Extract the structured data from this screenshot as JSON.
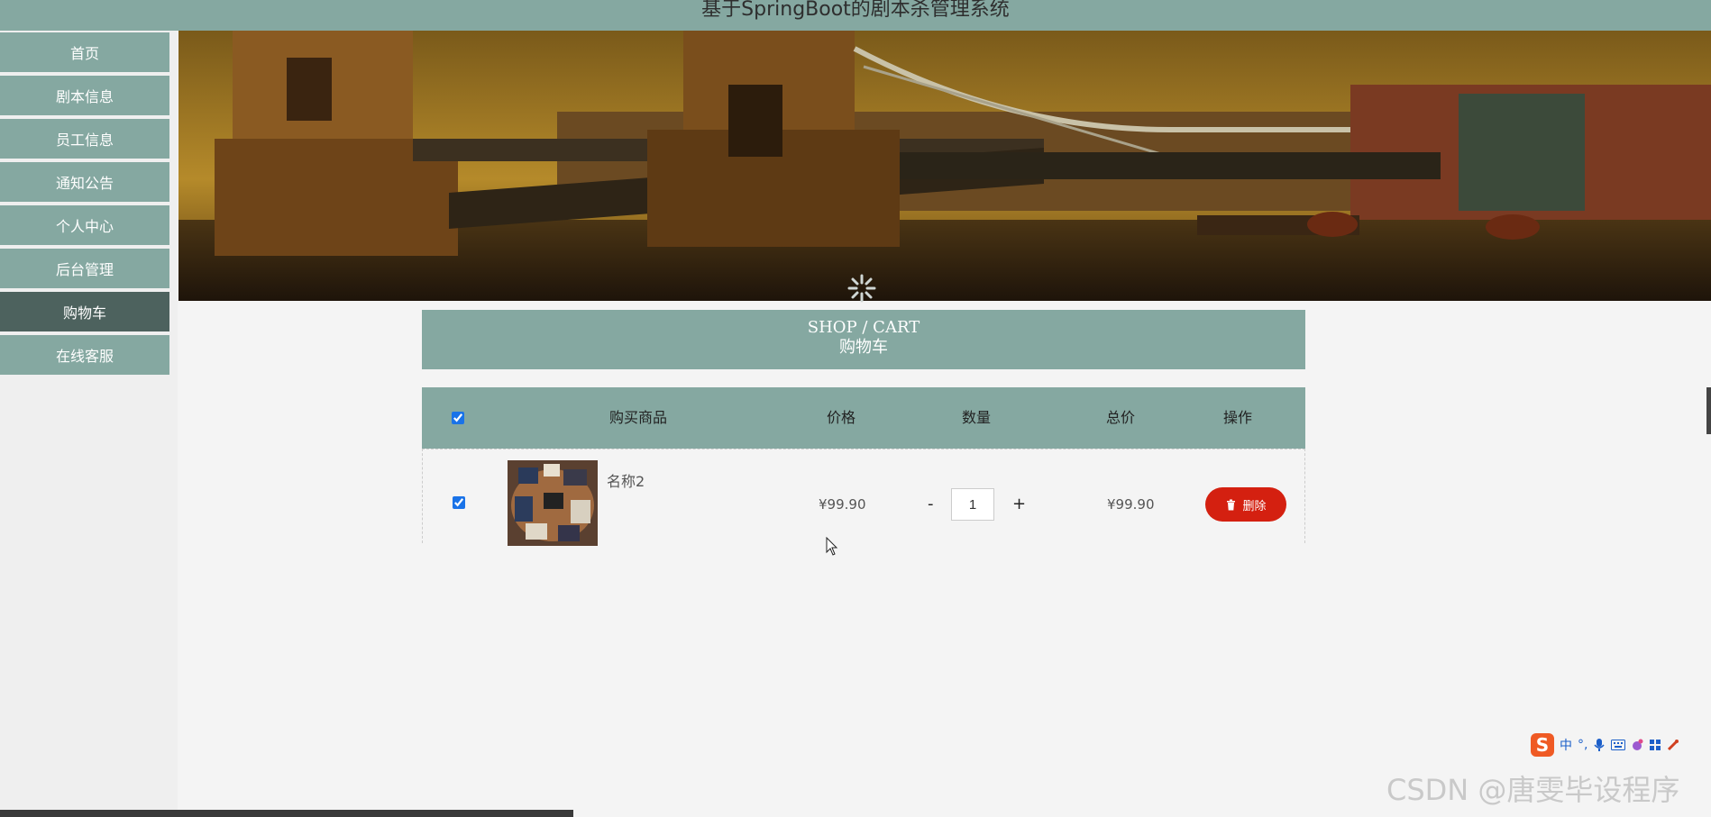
{
  "app": {
    "title": "基于SpringBoot的剧本杀管理系统"
  },
  "nav": {
    "items": [
      {
        "label": "首页"
      },
      {
        "label": "剧本信息"
      },
      {
        "label": "员工信息"
      },
      {
        "label": "通知公告"
      },
      {
        "label": "个人中心"
      },
      {
        "label": "后台管理"
      },
      {
        "label": "购物车",
        "active": true
      },
      {
        "label": "在线客服"
      }
    ]
  },
  "cart": {
    "heading_en": "SHOP / CART",
    "heading_cn": "购物车",
    "columns": {
      "select_all_checked": true,
      "product": "购买商品",
      "price": "价格",
      "quantity": "数量",
      "total": "总价",
      "actions": "操作"
    },
    "items": [
      {
        "checked": true,
        "name": "名称2",
        "price": "¥99.90",
        "quantity": "1",
        "minus_label": "-",
        "plus_label": "+",
        "total": "¥99.90",
        "delete_label": "删除"
      }
    ]
  },
  "overlay": {
    "watermark": "CSDN @唐雯毕设程序",
    "ime_logo": "S",
    "ime_mode": "中"
  },
  "colors": {
    "accent": "#85a8a1",
    "nav_active": "#4d625e",
    "delete": "#d42010"
  }
}
